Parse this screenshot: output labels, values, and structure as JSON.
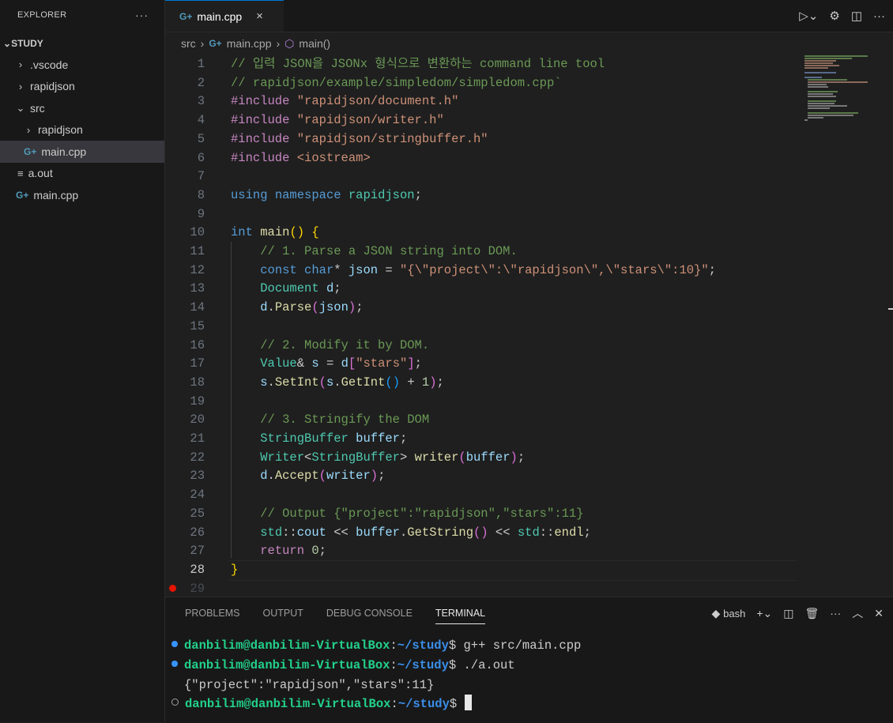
{
  "sidebar": {
    "header": "EXPLORER",
    "more": "···",
    "root": "STUDY",
    "items": [
      {
        "label": ".vscode",
        "type": "folder",
        "expanded": false,
        "depth": 1
      },
      {
        "label": "rapidjson",
        "type": "folder",
        "expanded": false,
        "depth": 1
      },
      {
        "label": "src",
        "type": "folder",
        "expanded": true,
        "depth": 1
      },
      {
        "label": "rapidjson",
        "type": "folder",
        "expanded": false,
        "depth": 2
      },
      {
        "label": "main.cpp",
        "type": "cpp",
        "selected": true,
        "depth": 2
      },
      {
        "label": "a.out",
        "type": "text",
        "depth": 1
      },
      {
        "label": "main.cpp",
        "type": "cpp",
        "depth": 1
      }
    ]
  },
  "tab": {
    "label": "main.cpp",
    "close": "×"
  },
  "breadcrumb": {
    "part1": "src",
    "part2": "main.cpp",
    "part3": "main()"
  },
  "editor": {
    "active_line": "28",
    "lines": [
      {
        "n": "1",
        "t": "cm",
        "text": "// 입력 JSON을 JSONx 형식으로 변환하는 command line tool"
      },
      {
        "n": "2",
        "t": "cm",
        "text": "// rapidjson/example/simpledom/simpledom.cpp`"
      },
      {
        "n": "3",
        "kw": "#include",
        "str": "\"rapidjson/document.h\""
      },
      {
        "n": "4",
        "kw": "#include",
        "str": "\"rapidjson/writer.h\""
      },
      {
        "n": "5",
        "kw": "#include",
        "str": "\"rapidjson/stringbuffer.h\""
      },
      {
        "n": "6",
        "kw": "#include",
        "str": "<iostream>"
      },
      {
        "n": "7"
      },
      {
        "n": "8"
      },
      {
        "n": "9"
      },
      {
        "n": "10"
      },
      {
        "n": "11",
        "cm": "// 1. Parse a JSON string into DOM."
      },
      {
        "n": "12"
      },
      {
        "n": "13"
      },
      {
        "n": "14"
      },
      {
        "n": "15"
      },
      {
        "n": "16",
        "cm": "// 2. Modify it by DOM."
      },
      {
        "n": "17"
      },
      {
        "n": "18"
      },
      {
        "n": "19"
      },
      {
        "n": "20",
        "cm": "// 3. Stringify the DOM"
      },
      {
        "n": "21"
      },
      {
        "n": "22"
      },
      {
        "n": "23"
      },
      {
        "n": "24"
      },
      {
        "n": "25",
        "cm": "// Output {\"project\":\"rapidjson\",\"stars\":11}"
      },
      {
        "n": "26"
      },
      {
        "n": "27"
      },
      {
        "n": "28"
      },
      {
        "n": "29"
      }
    ],
    "code": {
      "l8_using": "using",
      "l8_namespace": "namespace",
      "l8_name": "rapidjson;",
      "l10_int": "int",
      "l10_main": "main",
      "l12_const": "const",
      "l12_char": "char",
      "l12_rest": "* json = ",
      "l12_str": "\"{\\\"project\\\":\\\"rapidjson\\\",\\\"stars\\\":10}\"",
      "l13": "Document d;",
      "l14_d": "d",
      "l14_parse": "Parse",
      "l14_arg": "json",
      "l17_a": "Value& s = d",
      "l17_str": "\"stars\"",
      "l18_s": "s",
      "l18_set": "SetInt",
      "l18_s2": "s",
      "l18_get": "GetInt",
      "l18_num": "1",
      "l21": "StringBuffer buffer;",
      "l22_a": "Writer<StringBuffer> ",
      "l22_fn": "writer",
      "l22_arg": "buffer",
      "l23_d": "d",
      "l23_fn": "Accept",
      "l23_arg": "writer",
      "l26_std": "std",
      "l26_cout": "cout",
      "l26_buf": "buffer",
      "l26_get": "GetString",
      "l26_std2": "std",
      "l26_endl": "endl",
      "l27_ret": "return",
      "l27_num": "0"
    }
  },
  "panel": {
    "tabs": [
      "PROBLEMS",
      "OUTPUT",
      "DEBUG CONSOLE",
      "TERMINAL"
    ],
    "active_tab": "TERMINAL",
    "shell": "bash",
    "terminal": {
      "user": "danbilim@danbilim-VirtualBox",
      "path": "~/study",
      "cmd1": "g++ src/main.cpp",
      "cmd2": "./a.out",
      "output": "{\"project\":\"rapidjson\",\"stars\":11}"
    }
  },
  "colors": {
    "accent": "#0078d4",
    "keyword": "#569cd6",
    "string": "#ce9178",
    "comment": "#6a9955",
    "prompt_user": "#23d18b",
    "prompt_path": "#3b8eea"
  }
}
